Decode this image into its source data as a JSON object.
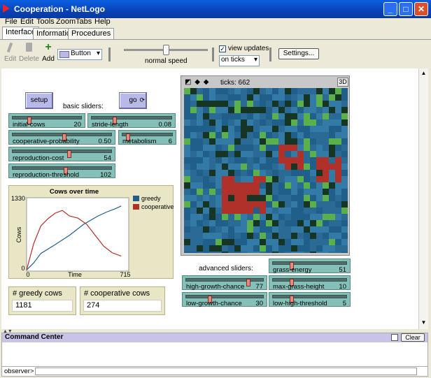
{
  "window": {
    "title": "Cooperation - NetLogo"
  },
  "menubar": [
    "File",
    "Edit",
    "Tools",
    "Zoom",
    "Tabs",
    "Help"
  ],
  "tabs": [
    "Interface",
    "Information",
    "Procedures"
  ],
  "toolbar": {
    "edit": "Edit",
    "delete": "Delete",
    "add": "Add",
    "widget_type": "Button",
    "speed_label": "normal speed",
    "view_updates": "view updates",
    "update_mode": "on ticks",
    "settings": "Settings..."
  },
  "buttons": {
    "setup": "setup",
    "go": "go"
  },
  "labels": {
    "basic": "basic sliders:",
    "advanced": "advanced sliders:"
  },
  "sliders": {
    "initial_cows": {
      "label": "initial-cows",
      "value": "20"
    },
    "stride_length": {
      "label": "stride-length",
      "value": "0.08"
    },
    "cooperative_probability": {
      "label": "cooperative-probability",
      "value": "0.50"
    },
    "metabolism": {
      "label": "metabolism",
      "value": "6"
    },
    "reproduction_cost": {
      "label": "reproduction-cost",
      "value": "54"
    },
    "reproduction_threshold": {
      "label": "reproduction-threshold",
      "value": "102"
    },
    "grass_energy": {
      "label": "grass-energy",
      "value": "51"
    },
    "high_growth_chance": {
      "label": "high-growth-chance",
      "value": "77"
    },
    "max_grass_height": {
      "label": "max-grass-height",
      "value": "10"
    },
    "low_growth_chance": {
      "label": "low-growth-chance",
      "value": "30"
    },
    "low_high_threshold": {
      "label": "low-high-threshold",
      "value": "5"
    }
  },
  "view": {
    "ticks": "ticks: 662",
    "three_d": "3D"
  },
  "monitors": {
    "greedy": {
      "label": "# greedy cows",
      "value": "1181"
    },
    "cooperative": {
      "label": "# cooperative cows",
      "value": "274"
    }
  },
  "command_center": {
    "title": "Command Center",
    "clear": "Clear",
    "prompt": "observer>"
  },
  "colors": {
    "greedy": "#1f5f8a",
    "cooperative": "#b0302a"
  },
  "chart_data": {
    "type": "line",
    "title": "Cows over time",
    "xlabel": "Time",
    "ylabel": "Cows",
    "xlim": [
      0,
      715
    ],
    "ylim": [
      0,
      1330
    ],
    "x_tick_labels": [
      "0",
      "715"
    ],
    "y_tick_labels": [
      "0",
      "1330"
    ],
    "legend": "right",
    "series": [
      {
        "name": "greedy",
        "x": [
          0,
          50,
          100,
          200,
          300,
          400,
          500,
          560,
          620,
          662
        ],
        "values": [
          20,
          150,
          320,
          480,
          650,
          850,
          1000,
          1070,
          1130,
          1181
        ]
      },
      {
        "name": "cooperative",
        "x": [
          0,
          50,
          100,
          150,
          200,
          250,
          300,
          360,
          420,
          480,
          540,
          600,
          662
        ],
        "values": [
          20,
          500,
          820,
          950,
          1050,
          1100,
          1000,
          960,
          850,
          650,
          450,
          330,
          274
        ]
      }
    ]
  }
}
